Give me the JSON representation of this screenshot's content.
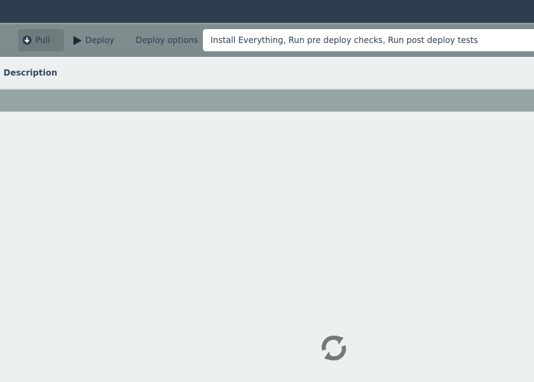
{
  "toolbar": {
    "pull_label": "Pull",
    "pull_icon": "download-circle-icon",
    "deploy_label": "Deploy",
    "deploy_icon": "play-icon",
    "options_label": "Deploy options",
    "options_value": "Install Everything, Run pre deploy checks, Run post deploy tests"
  },
  "table": {
    "columns": [
      "Description"
    ],
    "rows": []
  },
  "loading": {
    "icon": "refresh-icon"
  },
  "colors": {
    "top_bar": "#2c3e50",
    "toolbar": "#7f8c8d",
    "row_highlight": "#95a5a6",
    "background": "#ecf0f1"
  }
}
